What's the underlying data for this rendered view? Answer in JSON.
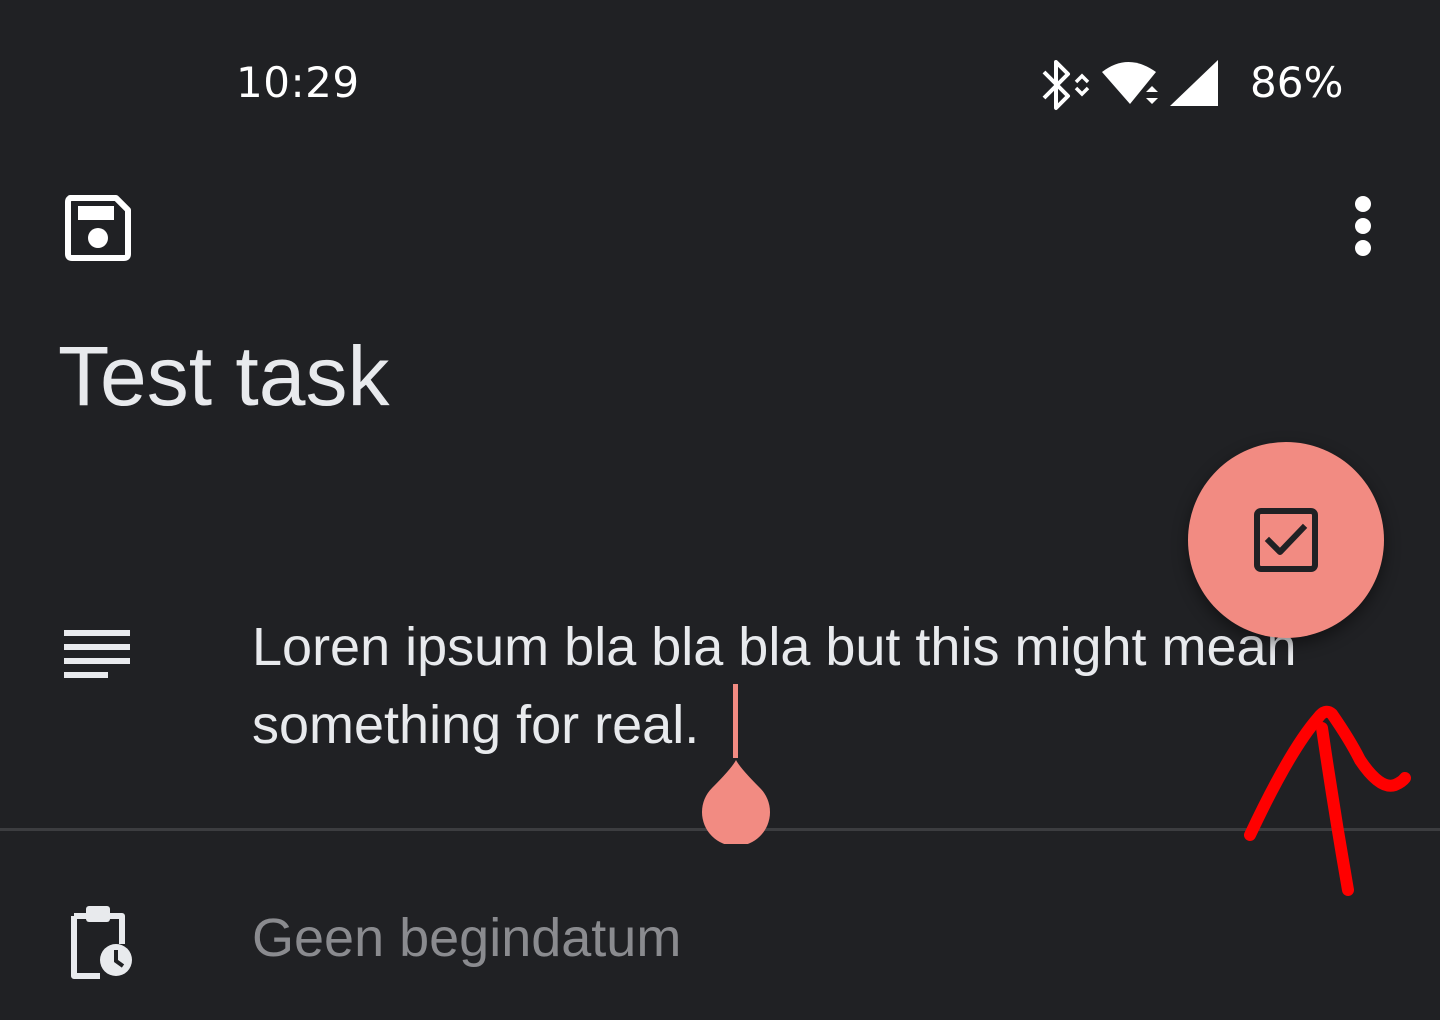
{
  "status_bar": {
    "time": "10:29",
    "battery": "86%",
    "icons": [
      "bluetooth-icon",
      "wifi-icon",
      "cell-signal-icon"
    ]
  },
  "toolbar": {
    "save_icon": "save-icon",
    "more_icon": "more-vert-icon"
  },
  "task": {
    "title": "Test task",
    "notes": "Loren ipsum bla bla bla but this might mean\nsomething for real.",
    "start_date": "Geen begindatum"
  },
  "fab": {
    "icon": "check-box-icon"
  },
  "colors": {
    "background": "#202124",
    "accent": "#f28b82",
    "text": "#e8eaed",
    "muted_text": "#8a8b8f",
    "annotation": "#ff0000"
  }
}
